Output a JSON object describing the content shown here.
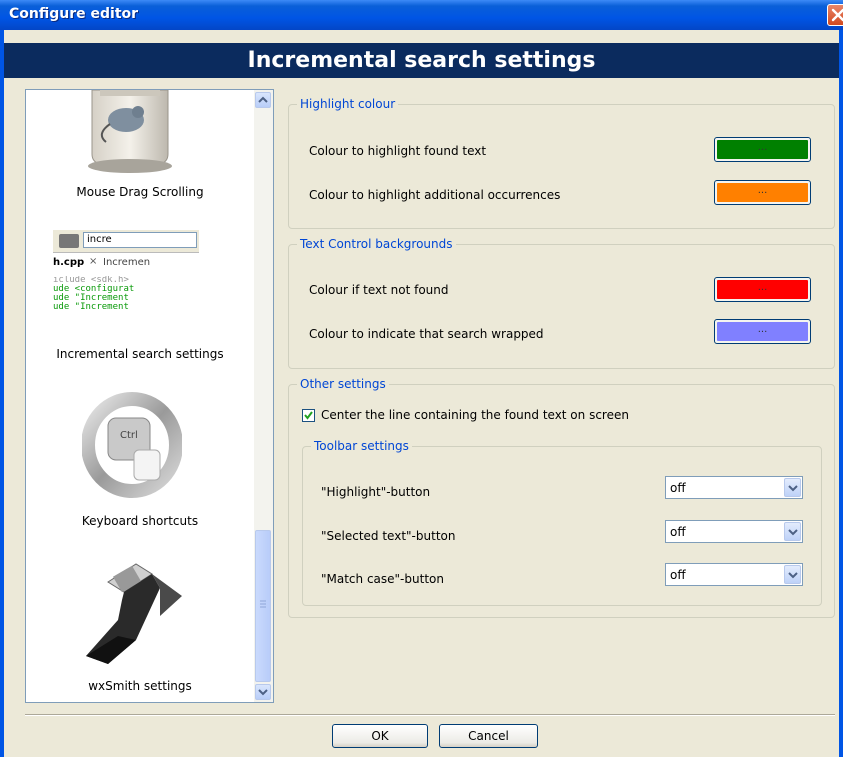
{
  "window": {
    "title": "Configure editor"
  },
  "header": {
    "title": "Incremental search settings"
  },
  "sidebar": {
    "items": [
      {
        "label": "Mouse Drag Scrolling",
        "icon": "mouse-icon"
      },
      {
        "label": "Incremental search settings",
        "icon": "incremental-search-icon",
        "thumb_search_text": "incre",
        "thumb_tab1": "h.cpp",
        "thumb_tab2": "Incremen",
        "thumb_code": [
          "iclude <sdk.h> ",
          "ude <configurat",
          "ude \"Increment",
          "ude \"Increment"
        ]
      },
      {
        "label": "Keyboard shortcuts",
        "icon": "keyboard-shortcuts-icon",
        "key_label": "Ctrl"
      },
      {
        "label": "wxSmith settings",
        "icon": "wxsmith-icon"
      }
    ]
  },
  "highlight": {
    "title": "Highlight colour",
    "rows": [
      {
        "label": "Colour to highlight found text",
        "color": "#008000",
        "button_text": "..."
      },
      {
        "label": "Colour to highlight additional occurrences",
        "color": "#ff8000",
        "button_text": "..."
      }
    ]
  },
  "backgrounds": {
    "title": "Text Control backgrounds",
    "rows": [
      {
        "label": "Colour if text not found",
        "color": "#ff0000",
        "button_text": "..."
      },
      {
        "label": "Colour to indicate that search wrapped",
        "color": "#8080ff",
        "button_text": "..."
      }
    ]
  },
  "other": {
    "title": "Other settings",
    "center_label": "Center the line containing the found text on screen",
    "center_checked": true
  },
  "toolbar": {
    "title": "Toolbar settings",
    "rows": [
      {
        "label": "\"Highlight\"-button",
        "value": "off"
      },
      {
        "label": "\"Selected text\"-button",
        "value": "off"
      },
      {
        "label": "\"Match case\"-button",
        "value": "off"
      }
    ]
  },
  "buttons": {
    "ok": "OK",
    "cancel": "Cancel"
  }
}
